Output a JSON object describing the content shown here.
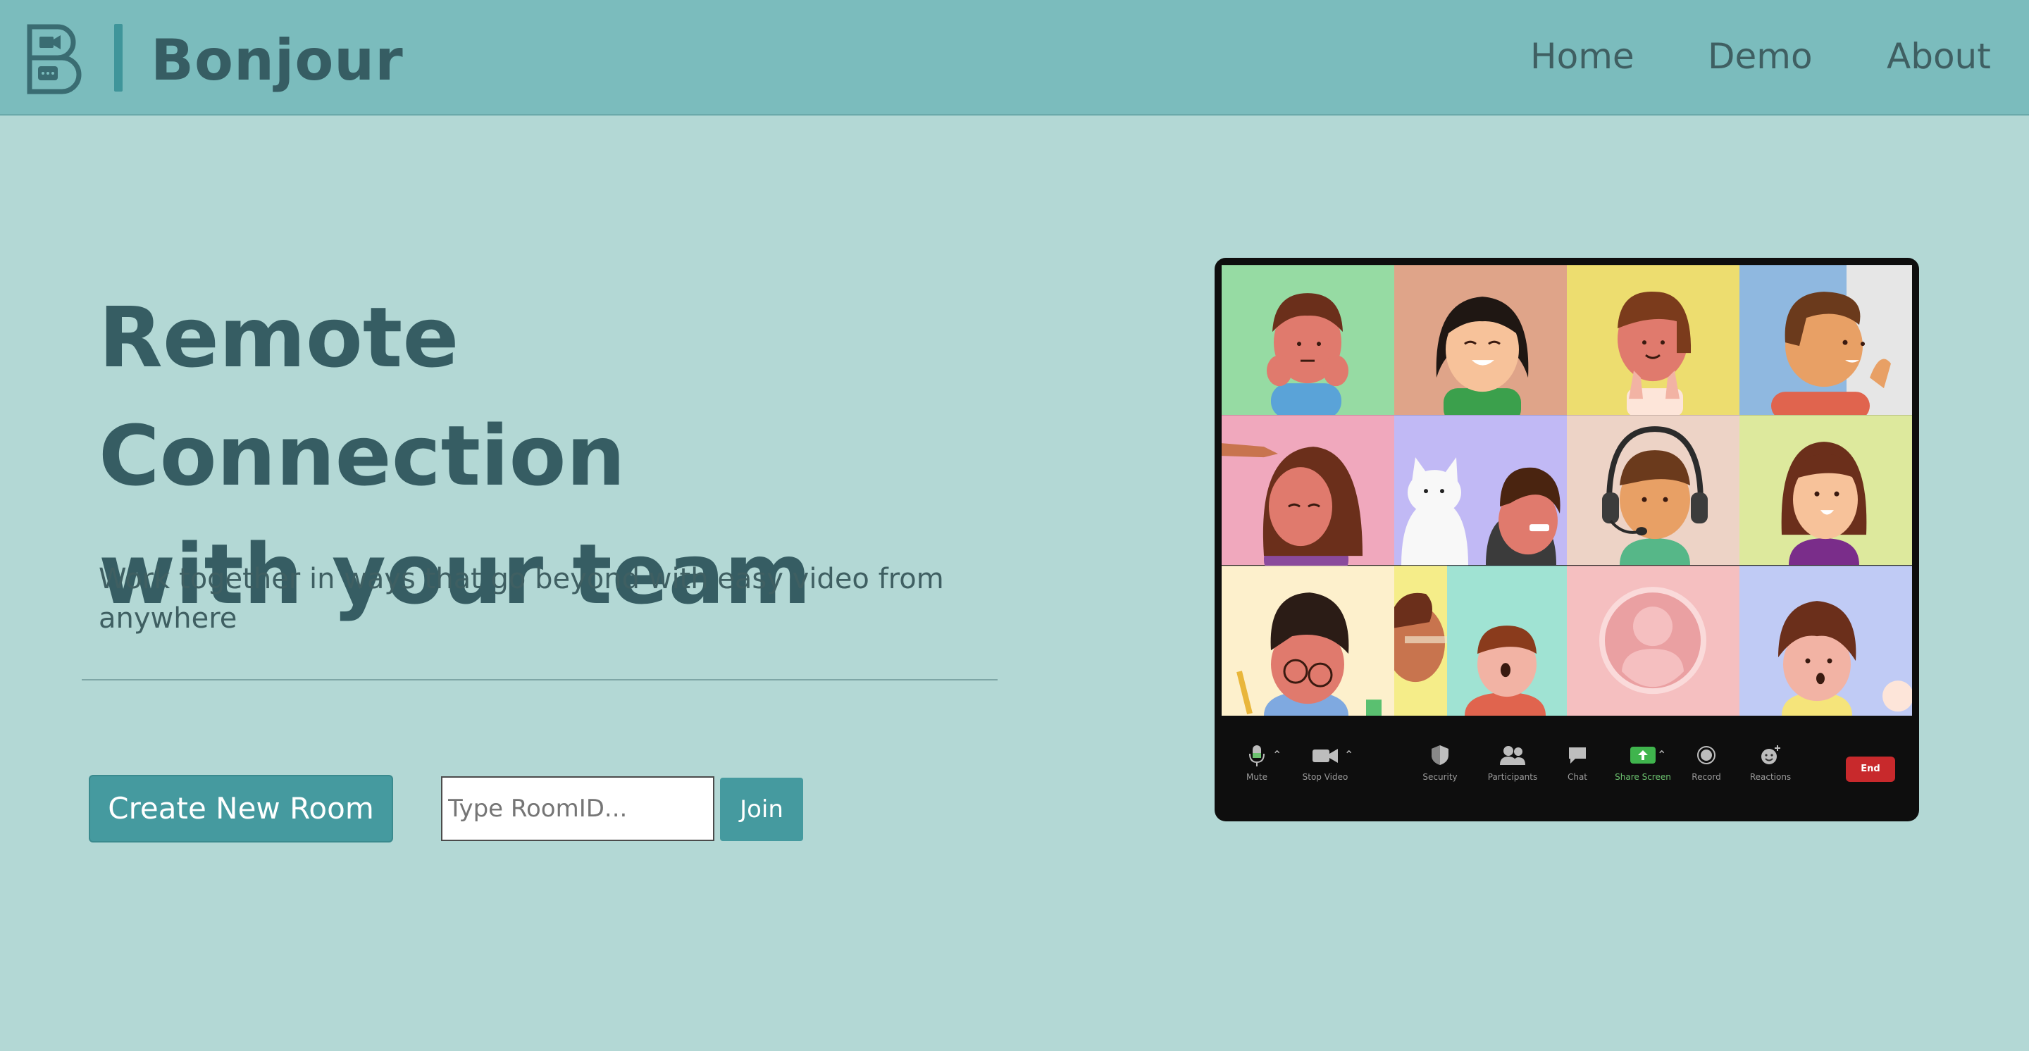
{
  "brand": {
    "name": "Bonjour",
    "logo": "bonjour-logo-b-camera"
  },
  "nav": {
    "home": "Home",
    "demo": "Demo",
    "about": "About"
  },
  "hero": {
    "headline_line1": "Remote Connection",
    "headline_line2": "with your team",
    "subtext": "Work together in ways that go beyond with easy video from anywhere"
  },
  "actions": {
    "create_room": "Create New Room",
    "room_placeholder": "Type RoomID...",
    "room_value": "",
    "join": "Join"
  },
  "illustration": {
    "toolbar": {
      "mute": "Mute",
      "stop_video": "Stop Video",
      "security": "Security",
      "participants": "Participants",
      "chat": "Chat",
      "share_screen": "Share Screen",
      "record": "Record",
      "reactions": "Reactions",
      "end": "End"
    }
  },
  "colors": {
    "page_bg": "#b3d8d5",
    "navbar_bg": "#7bbcbd",
    "primary_text": "#365d63",
    "accent": "#459a9f"
  }
}
